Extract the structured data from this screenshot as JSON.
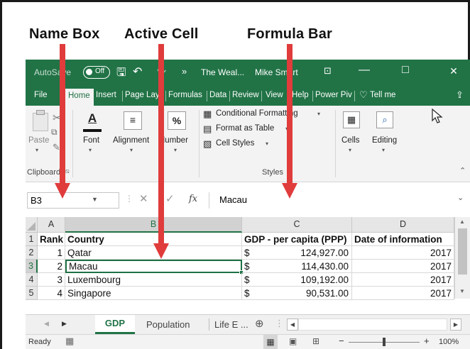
{
  "annotations": {
    "name_box": "Name Box",
    "active_cell": "Active Cell",
    "formula_bar": "Formula Bar"
  },
  "titlebar": {
    "autosave_label": "AutoSave",
    "autosave_state": "Off",
    "filename": "The Weal...",
    "user": "Mike Smart",
    "minimize": "—",
    "maximize": "□",
    "close": "✕"
  },
  "tabs": [
    "File",
    "Home",
    "Insert",
    "Page Layo",
    "Formulas",
    "Data",
    "Review",
    "View",
    "Help",
    "Power Piv"
  ],
  "tell_me": "Tell me",
  "ribbon": {
    "clipboard": {
      "paste": "Paste",
      "label": "Clipboard"
    },
    "font": "Font",
    "alignment": "Alignment",
    "number": "Number",
    "styles": {
      "conditional": "Conditional Formatting",
      "format_table": "Format as Table",
      "cell_styles": "Cell Styles",
      "label": "Styles"
    },
    "cells": "Cells",
    "editing": "Editing"
  },
  "formula_bar": {
    "name_box": "B3",
    "fx": "fx",
    "value": "Macau"
  },
  "grid": {
    "col_headers": [
      "A",
      "B",
      "C",
      "D"
    ],
    "row_headers": [
      "1",
      "2",
      "3",
      "4",
      "5"
    ],
    "header_row": [
      "Rank",
      "Country",
      "GDP - per capita (PPP)",
      "Date of information"
    ],
    "rows": [
      {
        "rank": "1",
        "country": "Qatar",
        "currency": "$",
        "gdp": "124,927.00",
        "date": "2017"
      },
      {
        "rank": "2",
        "country": "Macau",
        "currency": "$",
        "gdp": "114,430.00",
        "date": "2017"
      },
      {
        "rank": "3",
        "country": "Luxembourg",
        "currency": "$",
        "gdp": "109,192.00",
        "date": "2017"
      },
      {
        "rank": "4",
        "country": "Singapore",
        "currency": "$",
        "gdp": "90,531.00",
        "date": "2017"
      }
    ]
  },
  "sheets": {
    "active": "GDP",
    "others": [
      "Population",
      "Life E ..."
    ]
  },
  "status": {
    "ready": "Ready",
    "zoom": "100%"
  },
  "colors": {
    "excel_green": "#217346",
    "arrow_red": "#e03c3c",
    "selection_green": "#1e7145"
  }
}
